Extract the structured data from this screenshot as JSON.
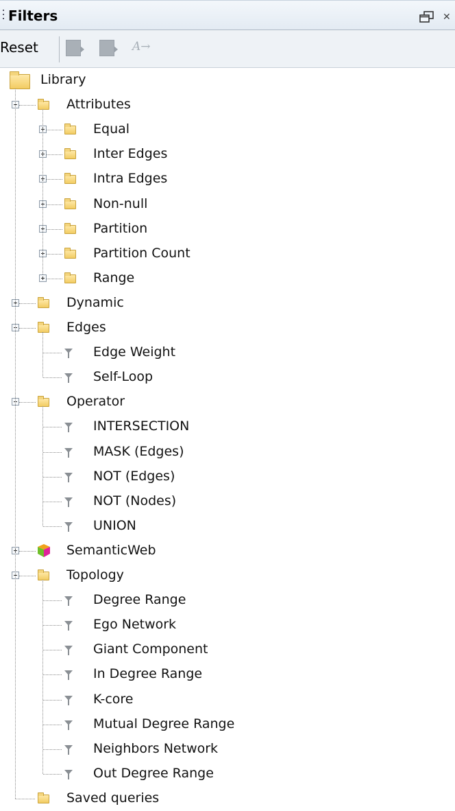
{
  "panel": {
    "title": "Filters",
    "restore_icon": "restore-window-icon",
    "close_icon": "close-icon",
    "close_glyph": "✕"
  },
  "toolbar": {
    "reset_label": "Reset",
    "icons": [
      "export-filter-icon",
      "import-filter-icon",
      "font-style-icon"
    ],
    "font_glyph": "A→"
  },
  "tree": {
    "root_label": "Library",
    "attributes": {
      "label": "Attributes",
      "children": [
        "Equal",
        "Inter Edges",
        "Intra Edges",
        "Non-null",
        "Partition",
        "Partition Count",
        "Range"
      ]
    },
    "dynamic": {
      "label": "Dynamic"
    },
    "edges": {
      "label": "Edges",
      "children": [
        "Edge Weight",
        "Self-Loop"
      ]
    },
    "operator": {
      "label": "Operator",
      "children": [
        "INTERSECTION",
        "MASK (Edges)",
        "NOT (Edges)",
        "NOT (Nodes)",
        "UNION"
      ]
    },
    "semanticweb": {
      "label": "SemanticWeb"
    },
    "topology": {
      "label": "Topology",
      "children": [
        "Degree Range",
        "Ego Network",
        "Giant Component",
        "In Degree Range",
        "K-core",
        "Mutual Degree Range",
        "Neighbors Network",
        "Out Degree Range"
      ]
    },
    "saved": {
      "label": "Saved queries"
    }
  },
  "colors": {
    "titlebar": "#e3ebf3",
    "toolbar": "#eef2f6",
    "folder": "#f2cc63",
    "tree_line": "#8a8a8a"
  }
}
